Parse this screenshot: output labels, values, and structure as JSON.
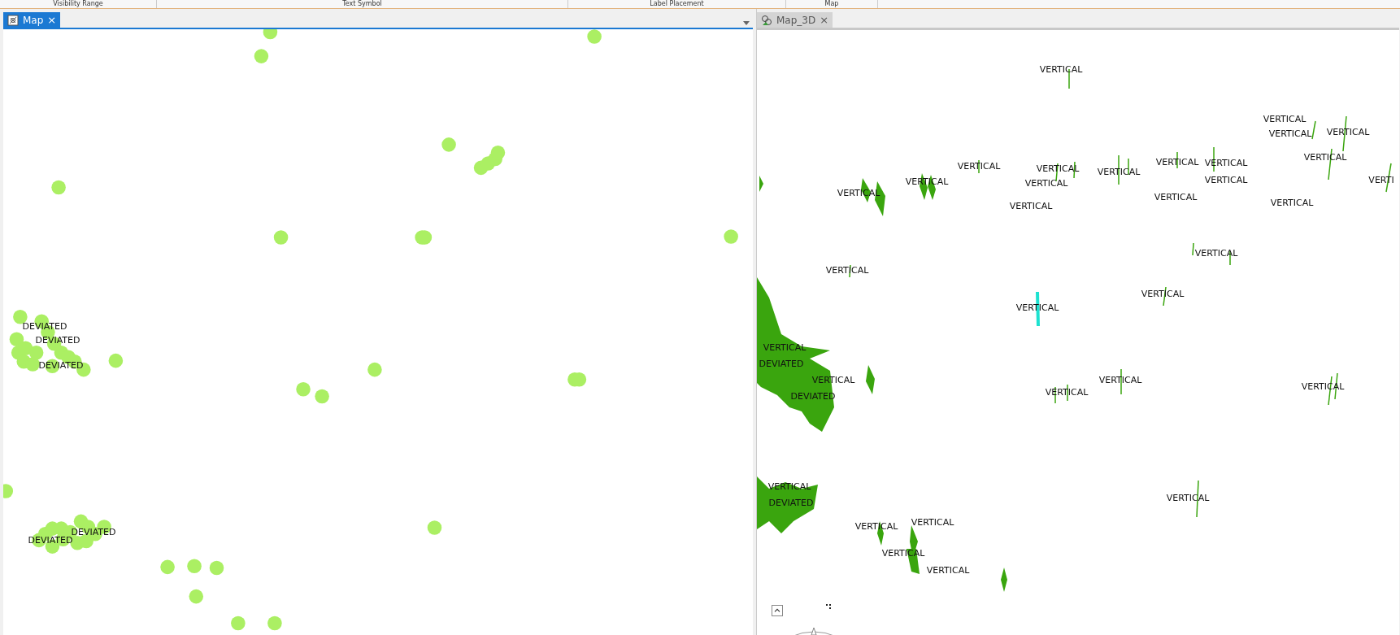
{
  "ribbon": {
    "group_labels": [
      "Visibility Range",
      "Text Symbol",
      "Label Placement",
      "Map"
    ]
  },
  "map_view": {
    "tab": {
      "label": "Map",
      "selected": true,
      "close": "×"
    },
    "labels": [
      "DEVIATED",
      "DEVIATED",
      "DEVIATED",
      "DEVIATED",
      "DEVIATED"
    ]
  },
  "map_3d_view": {
    "tab": {
      "label": "Map_3D",
      "selected": false,
      "close": "×"
    },
    "labels": [
      "VERTICAL",
      "VERTICAL",
      "VERTICAL",
      "VERTICAL",
      "VERTICAL",
      "VERTICAL",
      "VERTICAL",
      "VERTICAL",
      "VERTI",
      "VERTICAL",
      "VERTICAL",
      "VERTICAL",
      "VERTICAL",
      "VERTICAL",
      "VERTICAL",
      "VERTICAL",
      "VERTICAL",
      "VERTICAL",
      "VERTICAL",
      "VERTICAL",
      "VERTICAL",
      "VERTICAL",
      "VERTICAL",
      "DEVIATED",
      "VERTICAL",
      "DEVIATED",
      "VERTICAL",
      "VERTICAL",
      "VERTICAL",
      "VERTICAL",
      "DEVIATED",
      "VERTICAL",
      "VERTICAL",
      "VERTICAL",
      "VERTICAL",
      "VERTICAL"
    ]
  }
}
